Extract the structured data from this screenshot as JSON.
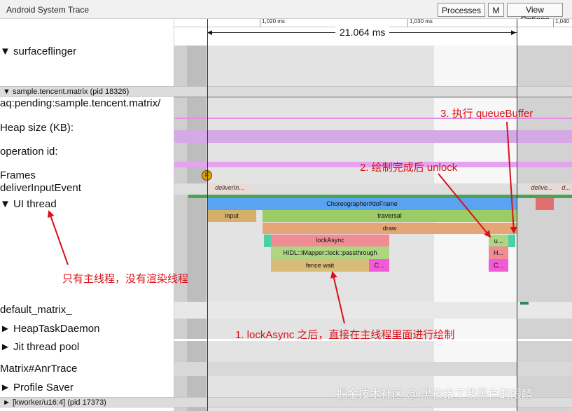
{
  "app": {
    "title": "Android System Trace"
  },
  "toolbar": {
    "processes": "Processes",
    "m": "M",
    "view_options": "View Options"
  },
  "ruler": {
    "ticks": [
      "1,020 ms",
      "1,030 ms",
      "1,040"
    ],
    "span_label": "21.064 ms"
  },
  "tracks": {
    "surfaceflinger": "▼  surfaceflinger",
    "process_header": "▼ sample.tencent.matrix (pid 18326)",
    "aq_pending": "aq:pending:sample.tencent.matrix/",
    "heap_size": "Heap size (KB):",
    "operation_id": "operation id:",
    "frames": "Frames",
    "deliver_input": "deliverInputEvent",
    "ui_thread": "▼  UI thread",
    "default_matrix": "default_matrix_",
    "heap_task_daemon": "►  HeapTaskDaemon",
    "jit_thread_pool": "►  Jit thread pool",
    "matrix_anr": "Matrix#AnrTrace",
    "profile_saver": "►  Profile Saver",
    "kworker_header": "► [kworker/u16:4] (pid 17373)"
  },
  "frame_marker": "F",
  "slices": {
    "deliver_in": "deliverIn...",
    "deliver_right": "delive...",
    "deliver_d": "d...",
    "choreographer": "Choreographer#doFrame",
    "input": "input",
    "traversal": "traversal",
    "draw": "draw",
    "lock_async": "lockAsync",
    "hidl": "HIDL::IMapper::lock::passthrough",
    "fence_wait": "fence wait",
    "c1": "C...",
    "u": "u...",
    "h": "H...",
    "c2": "C..."
  },
  "annotations": {
    "queue_buffer": "3. 执行 queueBuffer",
    "unlock": "2. 绘制完成后 unlock",
    "main_only": "只有主线程，没有渲染线程",
    "lock_async": "1. lockAsync 之后，直接在主线程里面进行绘制"
  },
  "watermark": "掘金技术社区 @ 黑夜给了我黑色的眼睛",
  "colors": {
    "choreographer": "#5aa3f0",
    "input": "#d4b06c",
    "traversal": "#9ccc65",
    "draw": "#e4a676",
    "lock_async": "#f08c94",
    "hidl": "#aed581",
    "fence_wait": "#d8bc78",
    "c_slice": "#f15bd6",
    "annotation": "#d8111a",
    "heap_band": "#d7a0e6"
  }
}
